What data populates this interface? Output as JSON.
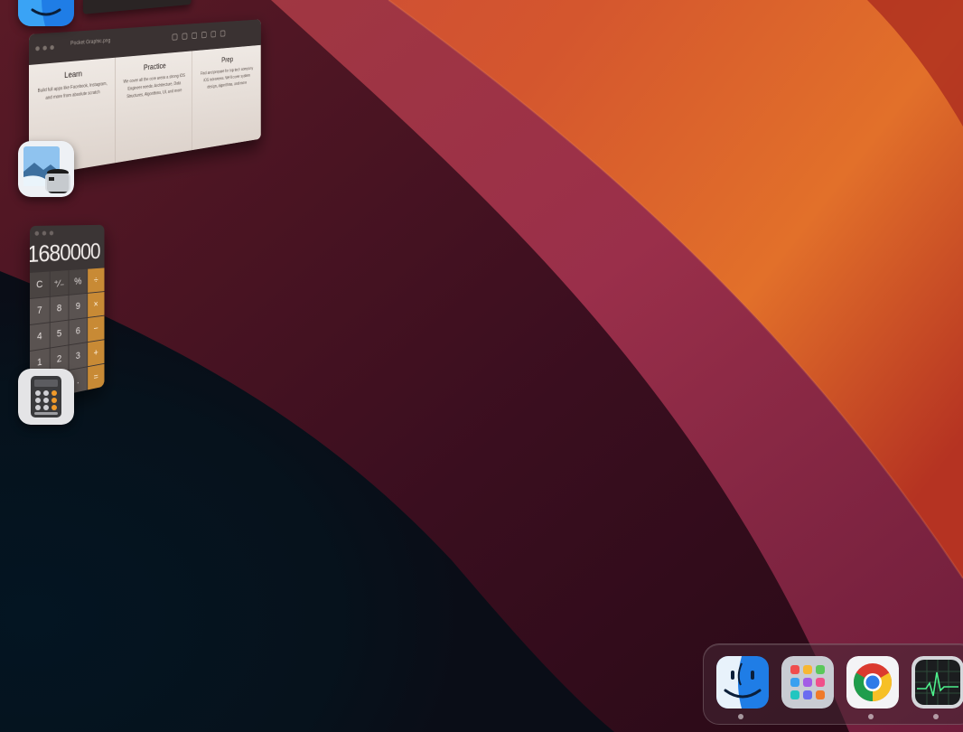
{
  "stage_manager": {
    "preview_window": {
      "title": "Pocket Graphic.png",
      "columns": [
        {
          "heading": "Learn",
          "lines": [
            "Build full apps like Facebook, Instagram,",
            "and more from absolute scratch"
          ]
        },
        {
          "heading": "Practice",
          "lines": [
            "We cover all the core areas a strong iOS",
            "Engineer needs: Architecture, Data",
            "Structures, Algorithms, UI, and more"
          ]
        },
        {
          "heading": "Prep",
          "lines": [
            "Find and prepare for top tech company",
            "iOS interviews. We'll cover system",
            "design, algorithms, and more"
          ]
        }
      ]
    },
    "calculator_window": {
      "display": "1680000",
      "keys": [
        "C",
        "⁺∕₋",
        "%",
        "÷",
        "7",
        "8",
        "9",
        "×",
        "4",
        "5",
        "6",
        "−",
        "1",
        "2",
        "3",
        "+",
        "0",
        "",
        ".",
        "="
      ]
    },
    "apps": [
      {
        "name": "Finder",
        "icon": "finder-icon"
      },
      {
        "name": "Preview",
        "icon": "preview-icon"
      },
      {
        "name": "Calculator",
        "icon": "calculator-icon"
      }
    ]
  },
  "dock": {
    "items": [
      {
        "name": "Finder",
        "icon": "finder-icon",
        "running": true
      },
      {
        "name": "Launchpad",
        "icon": "launchpad-icon",
        "running": false
      },
      {
        "name": "Google Chrome",
        "icon": "chrome-icon",
        "running": true
      },
      {
        "name": "Activity Monitor",
        "icon": "activity-monitor-icon",
        "running": true
      }
    ]
  },
  "colors": {
    "wallpaper_orange": "#e0642a",
    "wallpaper_red": "#a72a2a",
    "wallpaper_magenta": "#b04a8a",
    "wallpaper_dark": "#07141f",
    "calculator_operator": "#c88a35"
  }
}
